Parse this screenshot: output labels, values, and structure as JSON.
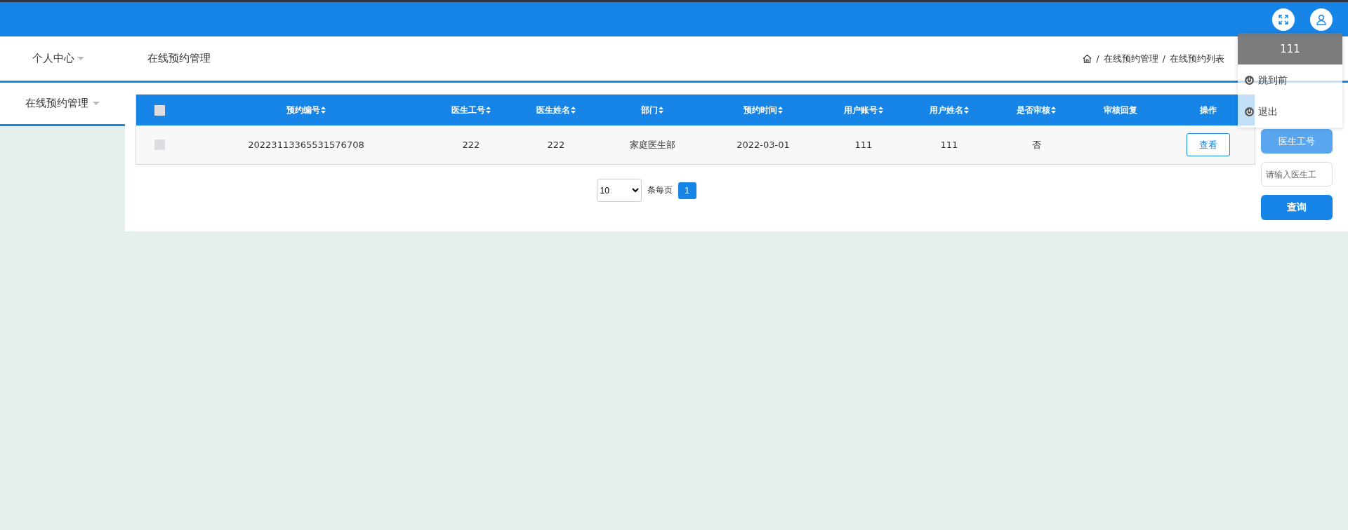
{
  "header": {
    "actions": [
      {
        "kind": "fullscreen"
      },
      {
        "kind": "user"
      }
    ]
  },
  "topnav": {
    "items": [
      {
        "label": "个人中心",
        "has_caret": true
      }
    ],
    "page_title": "在线预约管理",
    "breadcrumb": [
      "在线预约管理",
      "在线预约列表"
    ],
    "breadcrumb_separator": "/"
  },
  "user_menu": {
    "username": "111",
    "items": [
      "跳到前",
      "退出"
    ]
  },
  "sidebar": {
    "items": [
      {
        "label": "在线预约管理",
        "selected": true
      }
    ]
  },
  "table": {
    "select_all": {
      "checked": false
    },
    "columns": [
      {
        "label": "预约编号",
        "sortable": true
      },
      {
        "label": "医生工号",
        "sortable": true
      },
      {
        "label": "医生姓名",
        "sortable": true
      },
      {
        "label": "部门",
        "sortable": true
      },
      {
        "label": "预约时间",
        "sortable": true
      },
      {
        "label": "用户账号",
        "sortable": true
      },
      {
        "label": "用户姓名",
        "sortable": true
      },
      {
        "label": "是否审核",
        "sortable": true
      },
      {
        "label": "审核回复",
        "sortable": false
      },
      {
        "label": "操作",
        "sortable": false
      }
    ],
    "rows": [
      {
        "checked": false,
        "cells": [
          "20223113365531576708",
          "222",
          "222",
          "家庭医生部",
          "2022-03-01",
          "111",
          "111",
          "否",
          ""
        ],
        "action": "查看"
      }
    ]
  },
  "pagination": {
    "page_size": "10",
    "per_page_label": "条每页",
    "pages": [
      {
        "label": "1",
        "selected": true
      }
    ]
  },
  "search": {
    "label": "医生工号",
    "placeholder": "请输入医生工",
    "button": "查询"
  }
}
